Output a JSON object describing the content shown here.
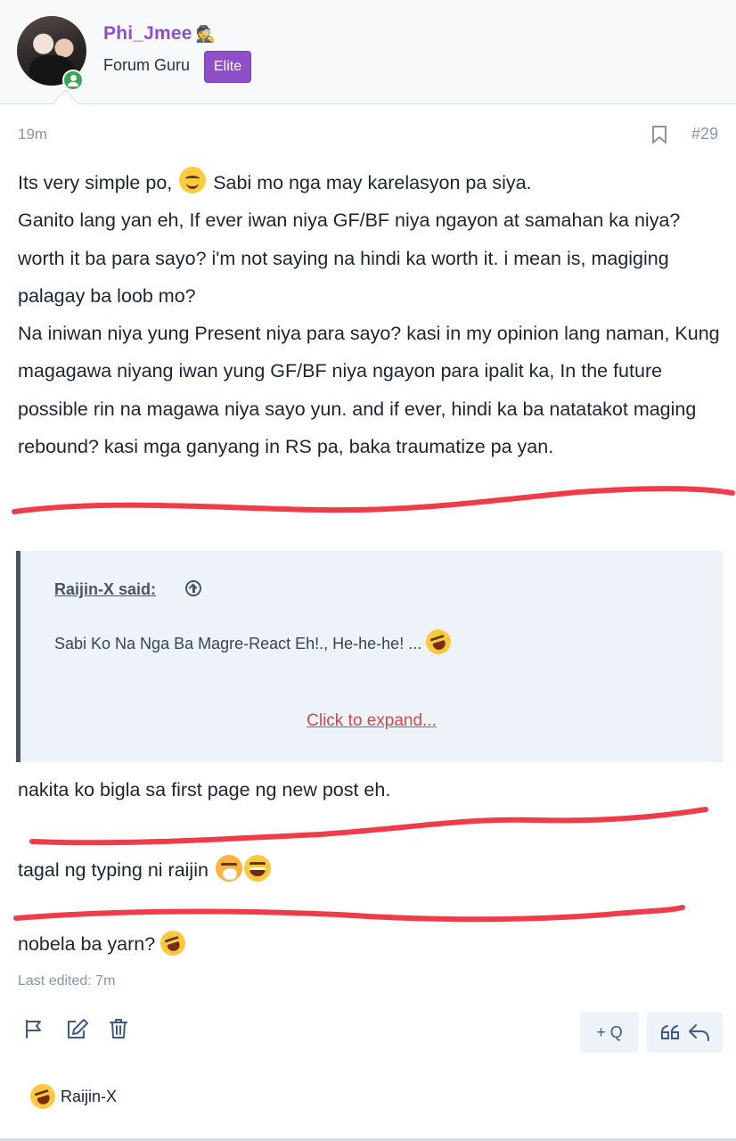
{
  "user": {
    "name": "Phi_Jmee",
    "name_icon": "spy-icon",
    "title": "Forum Guru",
    "badge": "Elite",
    "status": "online"
  },
  "post": {
    "time": "19m",
    "number": "#29",
    "paragraph_1a": "Its very simple po, ",
    "paragraph_1b": " Sabi mo nga may karelasyon pa siya.",
    "paragraph_2": "Ganito lang yan eh, If ever iwan niya GF/BF niya ngayon at samahan ka niya? worth it ba para sayo? i'm not saying na hindi ka worth it. i mean is, magiging palagay ba loob mo?",
    "paragraph_3": "Na iniwan niya yung Present niya para sayo? kasi in my opinion lang naman, Kung magagawa niyang iwan yung GF/BF niya ngayon para ipalit ka, In the future possible rin na magawa niya sayo yun. and if ever, hindi ka ba natatakot maging rebound? kasi mga ganyang in RS pa, baka traumatize pa yan.",
    "quote": {
      "author": "Raijin-X said:",
      "text": "Sabi Ko Na Nga Ba Magre-React Eh!., He-he-he! ... ",
      "expand_label": "Click to expand..."
    },
    "line_1": "nakita ko bigla sa first page ng new post eh.",
    "line_2": "tagal ng typing ni raijin ",
    "line_3": "nobela ba yarn? ",
    "last_edited": "Last edited: 7m"
  },
  "actions": {
    "report_icon": "flag-icon",
    "edit_icon": "edit-icon",
    "delete_icon": "trash-icon",
    "multiquote_label": "+ Q",
    "quote_icon": "quote-icon",
    "reply_icon": "reply-icon"
  },
  "reactions": {
    "user": "Raijin-X",
    "emoji": "rofl-emoji"
  },
  "colors": {
    "username": "#8e4fc9",
    "badge": "#8e4fc9",
    "expand_link": "#d04a4a",
    "scribble": "#f03c4a",
    "quote_bg": "#edf3f8"
  }
}
